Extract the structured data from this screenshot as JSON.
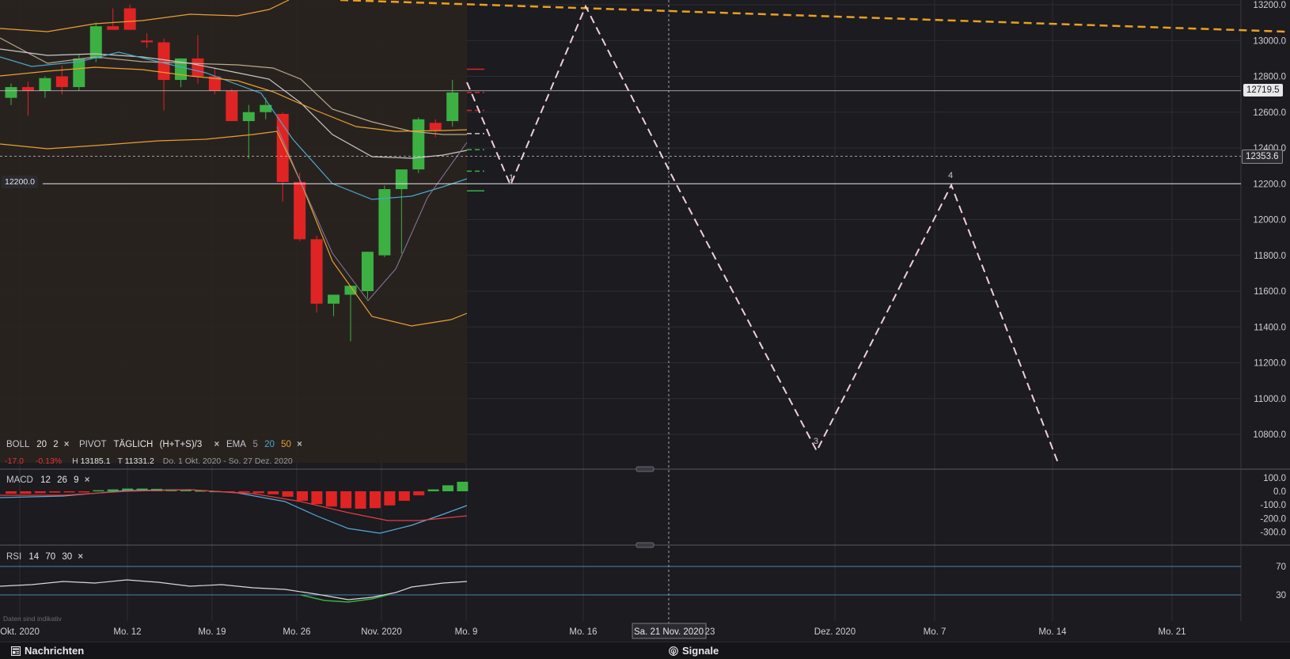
{
  "price_axis": {
    "ticks": [
      "13200.0",
      "13000.0",
      "12800.0",
      "12600.0",
      "12400.0",
      "12200.0",
      "12000.0",
      "11800.0",
      "11600.0",
      "11400.0",
      "11200.0",
      "11000.0",
      "10800.0"
    ],
    "current_price": "12719.5",
    "crosshair_price": "12353.6",
    "level_left": "12200.0"
  },
  "time_axis": {
    "labels": [
      "Okt. 2020",
      "Mo. 12",
      "Mo. 19",
      "Mo. 26",
      "Nov. 2020",
      "Mo. 9",
      "Mo. 16",
      "Sa. 21 Nov. 2020",
      "23",
      "Dez. 2020",
      "Mo. 7",
      "Mo. 14",
      "Mo. 21"
    ]
  },
  "overlay_legend": {
    "boll": {
      "name": "BOLL",
      "p1": "20",
      "p2": "2",
      "close": "×"
    },
    "pivot": {
      "name": "PIVOT",
      "p1": "TÄGLICH",
      "p2": "(H+T+S)/3",
      "close": "×"
    },
    "ema": {
      "name": "EMA",
      "p1": "5",
      "p2": "20",
      "p3": "50",
      "close": "×",
      "c1": "#9a9aa8",
      "c2": "#4aa8c8",
      "c3": "#e8a030"
    },
    "stats": {
      "change": "-17.0",
      "change_pct": "-0.13%",
      "high_label": "H",
      "high": "13185.1",
      "low_label": "T",
      "low": "11331.2",
      "range": "Do. 1 Okt. 2020 - So. 27 Dez. 2020"
    }
  },
  "macd": {
    "legend": {
      "name": "MACD",
      "p1": "12",
      "p2": "26",
      "p3": "9",
      "close": "×"
    },
    "ticks": [
      "100.0",
      "0.0",
      "-100.0",
      "-200.0",
      "-300.0"
    ]
  },
  "rsi": {
    "legend": {
      "name": "RSI",
      "p1": "14",
      "p2": "70",
      "p3": "30",
      "close": "×"
    },
    "ticks": [
      "70",
      "30"
    ],
    "note": "Daten sind indikativ"
  },
  "wave_labels": [
    "1",
    "3",
    "4"
  ],
  "bottom_bar": {
    "news_label": "Nachrichten",
    "signals_label": "Signale"
  },
  "colors": {
    "up": "#3cb043",
    "down": "#e02424",
    "boll_band": "#e8a030",
    "wave": "#f0d0d8",
    "trend": "#e8a020",
    "background": "#1b1b20"
  }
}
